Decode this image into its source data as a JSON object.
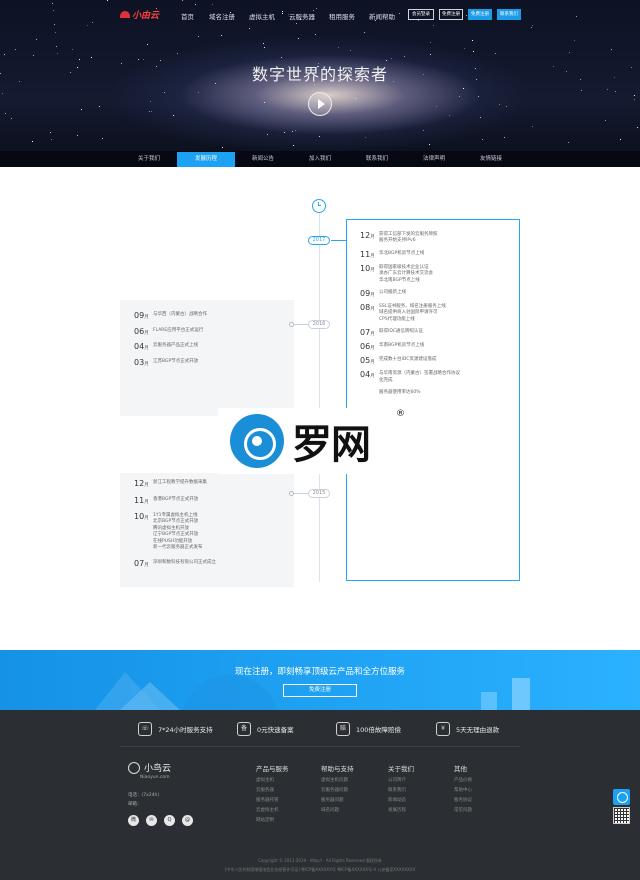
{
  "header": {
    "logo": "小由云",
    "nav": [
      "首页",
      "域名注册",
      "虚拟主机",
      "云服务器",
      "租用服务",
      "新闻帮助"
    ],
    "buttons": [
      "会员登录",
      "免费注册",
      "免费注册",
      "联系我们"
    ],
    "hero_title": "数字世界的探索者",
    "subnav": [
      "关于我们",
      "发展历程",
      "新闻公告",
      "加入我们",
      "联系我们",
      "法律声明",
      "友情链接"
    ],
    "subnav_active": 1
  },
  "timeline": {
    "year_2017": "2017",
    "year_2016": "2016",
    "year_2015": "2015",
    "y2017": [
      {
        "m": "12",
        "t": [
          "获得工信部下发的云服务牌照",
          "服务开始支持IPv6"
        ]
      },
      {
        "m": "11",
        "t": [
          "华北BGP机房节点上线"
        ]
      },
      {
        "m": "10",
        "t": [
          "取得国家级技术企业认证",
          "承办广东云计算技术交流会",
          "华北南BGP节点上线"
        ]
      },
      {
        "m": "09",
        "t": [
          "公司搬新上线"
        ]
      },
      {
        "m": "08",
        "t": [
          "SSL证书服务、域名注册服务上线",
          "域名提供商入驻国际申请许可",
          "CPS代理功能上线"
        ]
      },
      {
        "m": "07",
        "t": [
          "取得IDC通信牌照认证"
        ]
      },
      {
        "m": "06",
        "t": [
          "华南BGP机房节点上线"
        ]
      },
      {
        "m": "05",
        "t": [
          "完成数十台IDC资源建设落成"
        ]
      },
      {
        "m": "04",
        "t": [
          "与华南资源（内蒙古）签署战略合作协议",
          "化完成"
        ]
      },
      {
        "m": "",
        "t": [
          "服务器使用率达60%"
        ]
      }
    ],
    "y2016": [
      {
        "m": "09",
        "t": [
          "与华西（内蒙古）战略合作"
        ]
      },
      {
        "m": "06",
        "t": [
          "FLARE应用平台正式运行"
        ]
      },
      {
        "m": "04",
        "t": [
          "云服务器产品正式上线"
        ]
      },
      {
        "m": "03",
        "t": [
          "江苏BGP节点正式开放"
        ]
      }
    ],
    "y2015": [
      {
        "m": "12",
        "t": [
          "浙江工程教学提升数据采集"
        ]
      },
      {
        "m": "11",
        "t": [
          "香港BGP节点正式开放"
        ]
      },
      {
        "m": "10",
        "t": [
          "1Y1专属虚拟主机上线",
          "北京BGP节点正式开放",
          "腾讯虚拟主机开放",
          "辽宁BGP节点正式开放",
          "在线PUSH功能开放",
          "新一代云服务器正式发布"
        ]
      },
      {
        "m": "07",
        "t": [
          "深圳和数科技有限公司正式成立"
        ]
      }
    ],
    "month_suffix": "月"
  },
  "watermark": {
    "text": "罗网",
    "reg": "®"
  },
  "banner": {
    "title": "现在注册，即刻畅享顶级云产品和全方位服务",
    "button": "免费注册"
  },
  "footer": {
    "features": [
      {
        "icon": "phone-icon",
        "glyph": "☏",
        "label": "7*24小时服务支持"
      },
      {
        "icon": "filing-icon",
        "glyph": "备",
        "label": "0元快速备案"
      },
      {
        "icon": "refund-icon",
        "glyph": "赔",
        "label": "100倍故障赔偿"
      },
      {
        "icon": "yen-icon",
        "glyph": "¥",
        "label": "5天无理由退款"
      }
    ],
    "brand": "小鸟云",
    "brand_sub": "Niaoyun.com",
    "phone_label": "电话：(7x24h)",
    "email_label": "邮箱：",
    "columns": [
      {
        "title": "产品与服务",
        "items": [
          "虚拟主机",
          "云服务器",
          "服务器托管",
          "云虚拟主机",
          "网站定制"
        ]
      },
      {
        "title": "帮助与支持",
        "items": [
          "虚拟主机问题",
          "云服务器问题",
          "服务器问题",
          "域名问题"
        ]
      },
      {
        "title": "关于我们",
        "items": [
          "公司简介",
          "联系我们",
          "新闻动态",
          "发展历程"
        ]
      },
      {
        "title": "其他",
        "items": [
          "产品价格",
          "帮助中心",
          "服务协议",
          "常见问题"
        ]
      }
    ],
    "copyright": "Copyright © 2011-2019 · http://  · All Rights Reserved 版权所有",
    "icp": "[中华人民共和国增值电信业务经营许可证]  粤ICP备XXXXXX号   粤ICP备XXXXXX号-X 公安备案XXXXXXXX"
  }
}
